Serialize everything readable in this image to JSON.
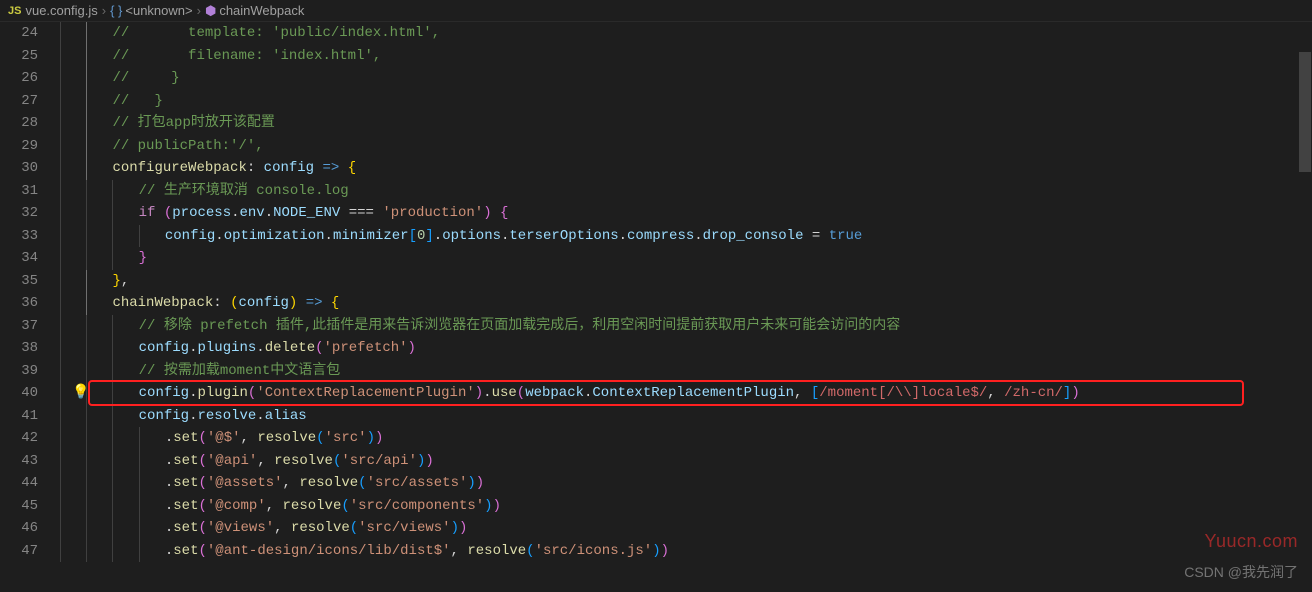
{
  "breadcrumb": {
    "file": "vue.config.js",
    "segment2": "<unknown>",
    "segment3": "chainWebpack"
  },
  "startLine": 24,
  "code": {
    "l24": "//       template: 'public/index.html',",
    "l25": "//       filename: 'index.html',",
    "l26": "//     }",
    "l27": "//   }",
    "l28": "// 打包app时放开该配置",
    "l29": "// publicPath:'/',",
    "l30_prop": "configureWebpack",
    "l30_param": "config",
    "l31": "// 生产环境取消 console.log",
    "l32_if": "if",
    "l32_process": "process",
    "l32_env": "env",
    "l32_node": "NODE_ENV",
    "l32_str": "'production'",
    "l33_config": "config",
    "l33_opt": "optimization",
    "l33_min": "minimizer",
    "l33_idx": "0",
    "l33_options": "options",
    "l33_terser": "terserOptions",
    "l33_compress": "compress",
    "l33_drop": "drop_console",
    "l33_true": "true",
    "l36_prop": "chainWebpack",
    "l36_param": "config",
    "l37": "// 移除 prefetch 插件,此插件是用来告诉浏览器在页面加载完成后，利用空闲时间提前获取用户未来可能会访问的内容",
    "l38_config": "config",
    "l38_plugins": "plugins",
    "l38_delete": "delete",
    "l38_str": "'prefetch'",
    "l39": "// 按需加载moment中文语言包",
    "l40_config": "config",
    "l40_plugin": "plugin",
    "l40_str1": "'ContextReplacementPlugin'",
    "l40_use": "use",
    "l40_webpack": "webpack",
    "l40_crp": "ContextReplacementPlugin",
    "l40_regex1": "/moment[/\\\\]locale$/",
    "l40_regex2": "/zh-cn/",
    "l41_config": "config",
    "l41_resolve": "resolve",
    "l41_alias": "alias",
    "l42_set": "set",
    "l42_key": "'@$'",
    "l42_resolve": "resolve",
    "l42_val": "'src'",
    "l43_set": "set",
    "l43_key": "'@api'",
    "l43_resolve": "resolve",
    "l43_val": "'src/api'",
    "l44_set": "set",
    "l44_key": "'@assets'",
    "l44_resolve": "resolve",
    "l44_val": "'src/assets'",
    "l45_set": "set",
    "l45_key": "'@comp'",
    "l45_resolve": "resolve",
    "l45_val": "'src/components'",
    "l46_set": "set",
    "l46_key": "'@views'",
    "l46_resolve": "resolve",
    "l46_val": "'src/views'",
    "l47_set": "set",
    "l47_key": "'@ant-design/icons/lib/dist$'",
    "l47_resolve": "resolve",
    "l47_val": "'src/icons.js'"
  },
  "watermark1": "Yuucn.com",
  "watermark2": "CSDN @我先润了"
}
